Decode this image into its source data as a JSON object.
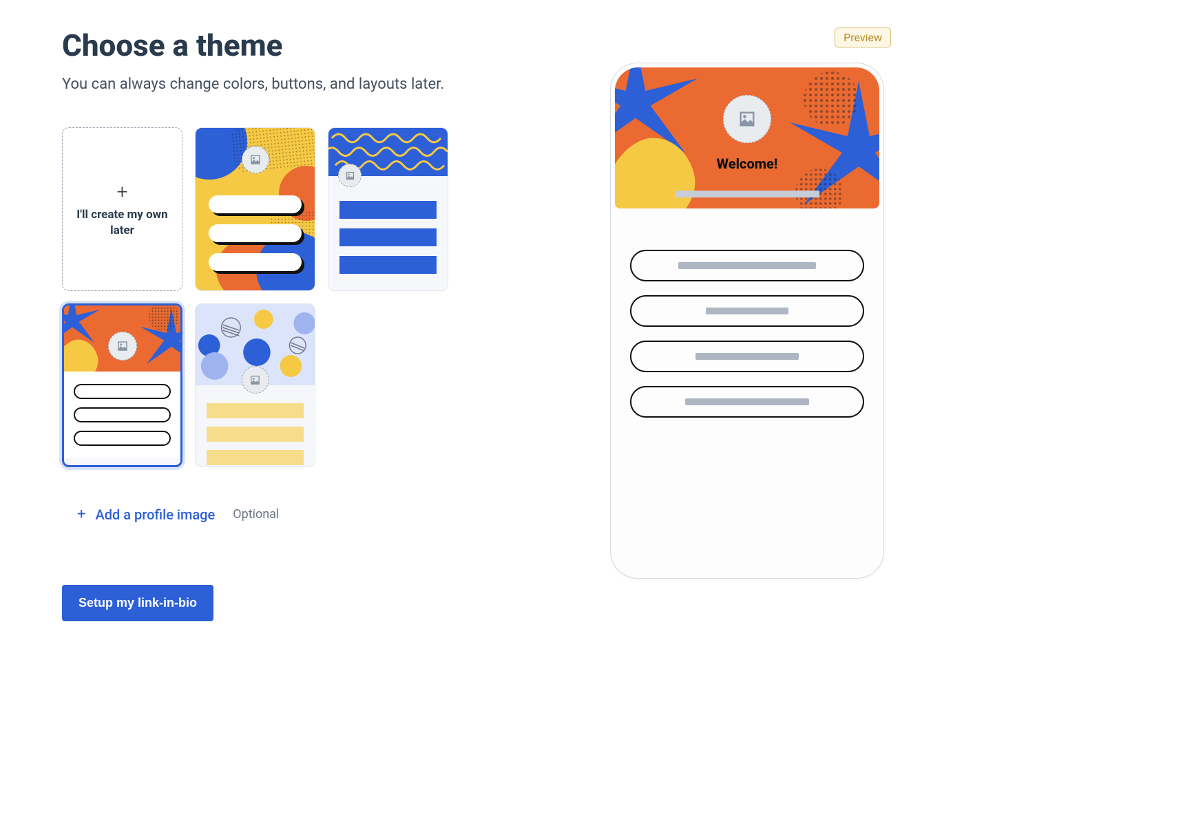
{
  "heading": "Choose a theme",
  "subheading": "You can always change colors, buttons, and layouts later.",
  "themes": {
    "own_later": "I'll create my own later"
  },
  "add_profile": {
    "label": "Add a profile image",
    "optional": "Optional"
  },
  "cta": "Setup my link-in-bio",
  "preview": {
    "badge": "Preview",
    "welcome": "Welcome!",
    "link_widths": [
      200,
      120,
      150,
      180
    ]
  }
}
